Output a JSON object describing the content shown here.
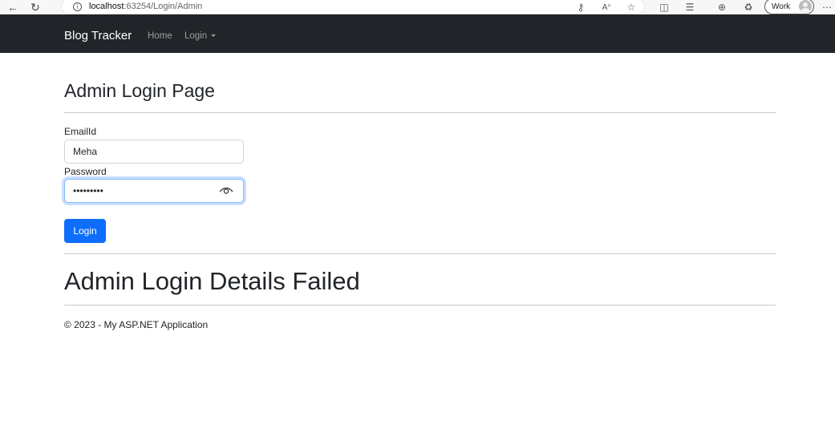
{
  "browser": {
    "url_host": "localhost",
    "url_rest": ":63254/Login/Admin",
    "profile_label": "Work",
    "icons": [
      "back-icon",
      "refresh-icon",
      "info-icon",
      "key-icon",
      "read-aloud-icon",
      "favorite-icon",
      "split-screen-icon",
      "favorites-list-icon",
      "collections-icon",
      "extensions-icon",
      "profile-avatar-icon",
      "more-icon"
    ]
  },
  "navbar": {
    "brand": "Blog Tracker",
    "links": [
      {
        "label": "Home"
      },
      {
        "label": "Login"
      }
    ]
  },
  "page": {
    "title": "Admin Login Page"
  },
  "form": {
    "email_label": "EmailId",
    "email_value": "Meha",
    "password_label": "Password",
    "password_value": "•••••••••",
    "login_label": "Login"
  },
  "status": {
    "message": "Admin Login Details Failed"
  },
  "footer": {
    "text": "© 2023 - My ASP.NET Application"
  },
  "colors": {
    "navbar_bg": "#212529",
    "primary": "#0d6efd",
    "focus_ring": "#86b7fe"
  }
}
